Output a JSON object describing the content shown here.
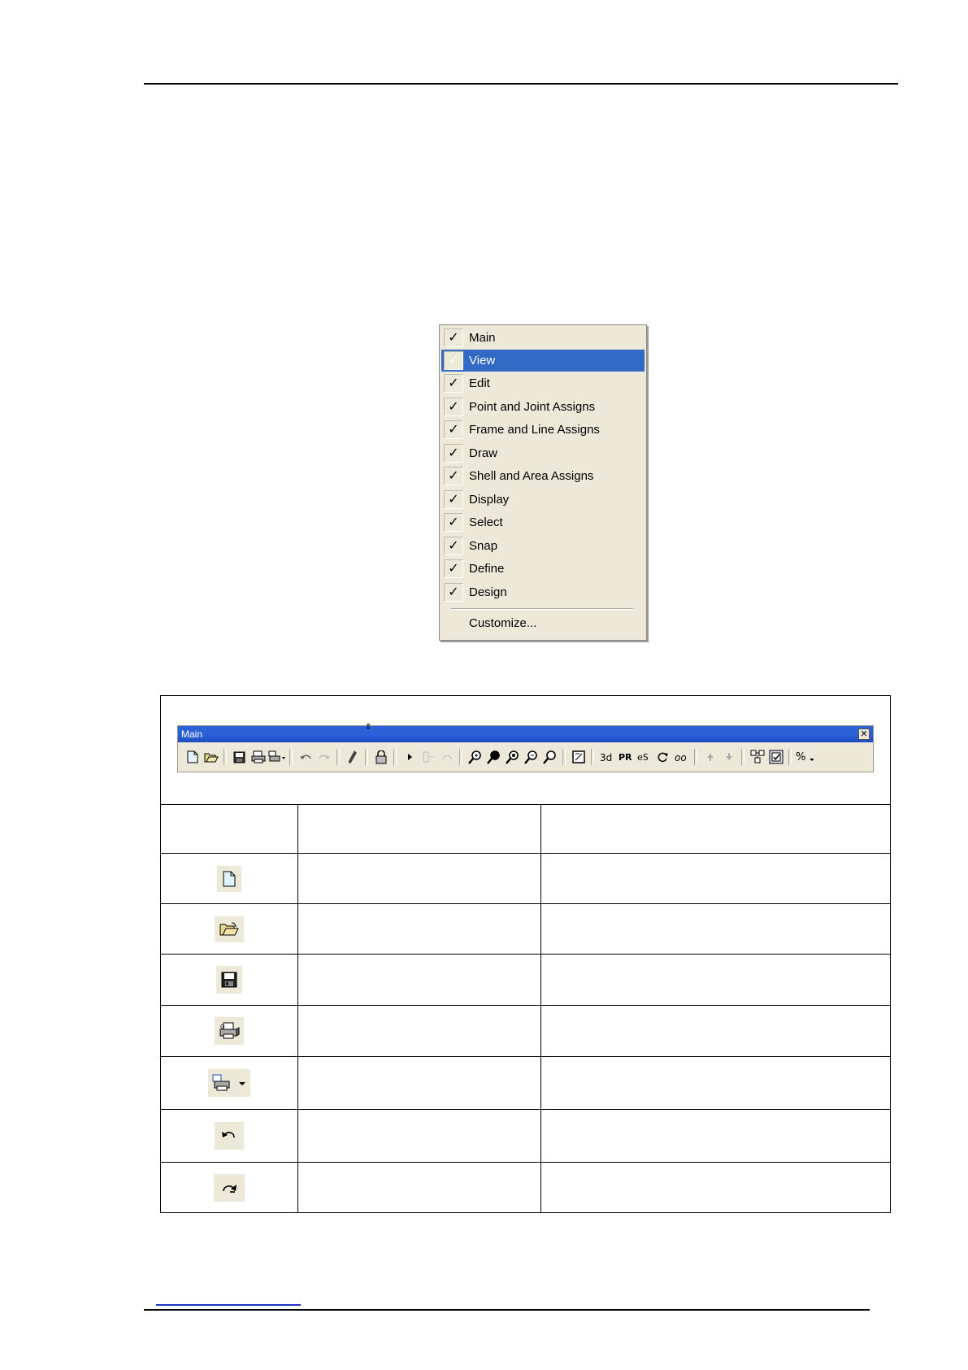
{
  "menu": {
    "items": [
      {
        "label": "Main",
        "checked": true
      },
      {
        "label": "View",
        "checked": true,
        "selected": true
      },
      {
        "label": "Edit",
        "checked": true
      },
      {
        "label": "Point and Joint Assigns",
        "checked": true
      },
      {
        "label": "Frame and Line Assigns",
        "checked": true
      },
      {
        "label": "Draw",
        "checked": true
      },
      {
        "label": "Shell and Area Assigns",
        "checked": true
      },
      {
        "label": "Display",
        "checked": true
      },
      {
        "label": "Select",
        "checked": true
      },
      {
        "label": "Snap",
        "checked": true
      },
      {
        "label": "Define",
        "checked": true
      },
      {
        "label": "Design",
        "checked": true
      }
    ],
    "customize_label": "Customize...",
    "check_glyph": "✓",
    "highlight_color": "#316ac5"
  },
  "toolbar": {
    "title": "Main",
    "close_glyph": "✕",
    "title_color": "#2a5fd6",
    "icons": [
      "new-file-icon",
      "open-folder-icon",
      "save-icon",
      "print-graphics-icon",
      "print-tables-icon",
      "undo-icon",
      "redo-icon",
      "refresh-icon",
      "lock-icon",
      "run-icon",
      "step-icon",
      "zoom-window-icon",
      "zoom-in-icon",
      "zoom-out-icon",
      "zoom-restore-icon",
      "zoom-pan-icon",
      "rubber-band-icon",
      "3d-view-icon",
      "plan-view-icon",
      "elevation-view-icon",
      "rotate-icon",
      "perspective-icon",
      "up-arrow-icon",
      "down-arrow-icon",
      "object-shrink-icon",
      "set-display-icon",
      "units-icon"
    ]
  },
  "table": {
    "rows": [
      {
        "icon": "new-file-icon",
        "name": "",
        "description": ""
      },
      {
        "icon": "open-folder-icon",
        "name": "",
        "description": ""
      },
      {
        "icon": "save-icon",
        "name": "",
        "description": ""
      },
      {
        "icon": "print-graphics-icon",
        "name": "",
        "description": ""
      },
      {
        "icon": "print-tables-dropdown-icon",
        "name": "",
        "description": ""
      },
      {
        "icon": "undo-icon",
        "name": "",
        "description": ""
      },
      {
        "icon": "redo-icon",
        "name": "",
        "description": ""
      }
    ]
  }
}
